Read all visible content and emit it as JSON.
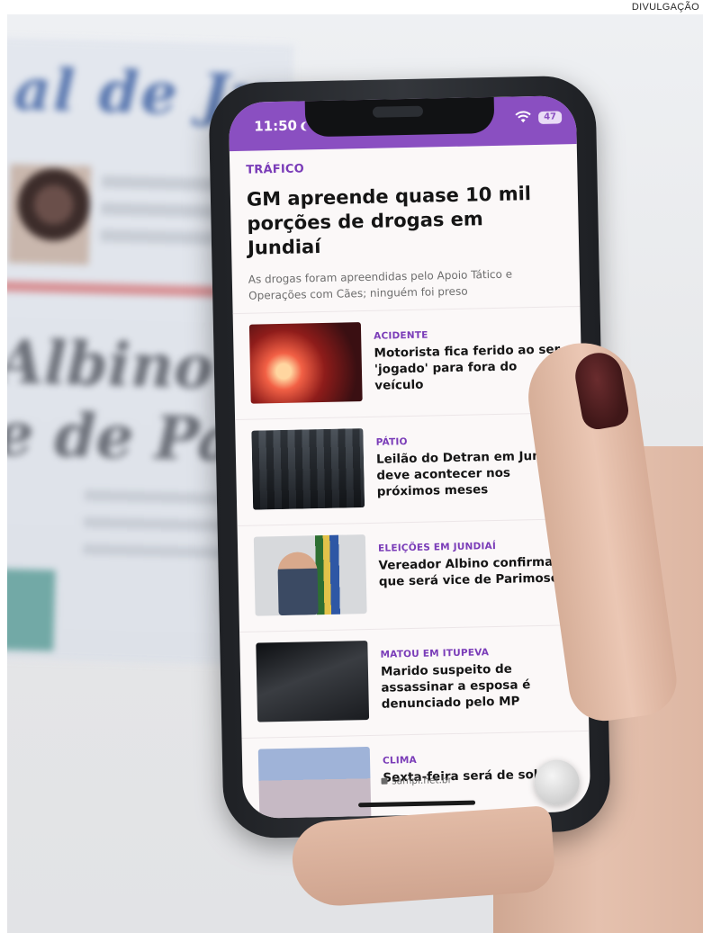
{
  "credit": "DIVULGAÇÃO",
  "status_bar": {
    "time": "11:50",
    "battery": "47",
    "accent_color": "#8a4fc1"
  },
  "lead_article": {
    "category": "TRÁFICO",
    "headline": "GM apreende quase 10 mil porções de drogas em Jundiaí",
    "summary": "As drogas foram apreendidas pelo Apoio Tático e Operações com Cães; ninguém foi preso"
  },
  "articles": [
    {
      "category": "ACIDENTE",
      "title": "Motorista fica ferido ao ser 'jogado' para fora do veículo"
    },
    {
      "category": "PÁTIO",
      "title": "Leilão do Detran em Jundiaí deve acontecer nos próximos meses"
    },
    {
      "category": "ELEIÇÕES EM JUNDIAÍ",
      "title": "Vereador Albino confirma que será vice de Parimoschi"
    },
    {
      "category": "MATOU EM ITUPEVA",
      "title": "Marido suspeito de assassinar a esposa é denunciado pelo MP"
    },
    {
      "category": "CLIMA",
      "title": "Sexta-feira será de sol e"
    }
  ],
  "browser": {
    "url": "sampi.net.br"
  },
  "background_newspaper": {
    "masthead": "al de Ju",
    "headline_line1": "Albino con",
    "headline_line2": "e de Parim"
  }
}
